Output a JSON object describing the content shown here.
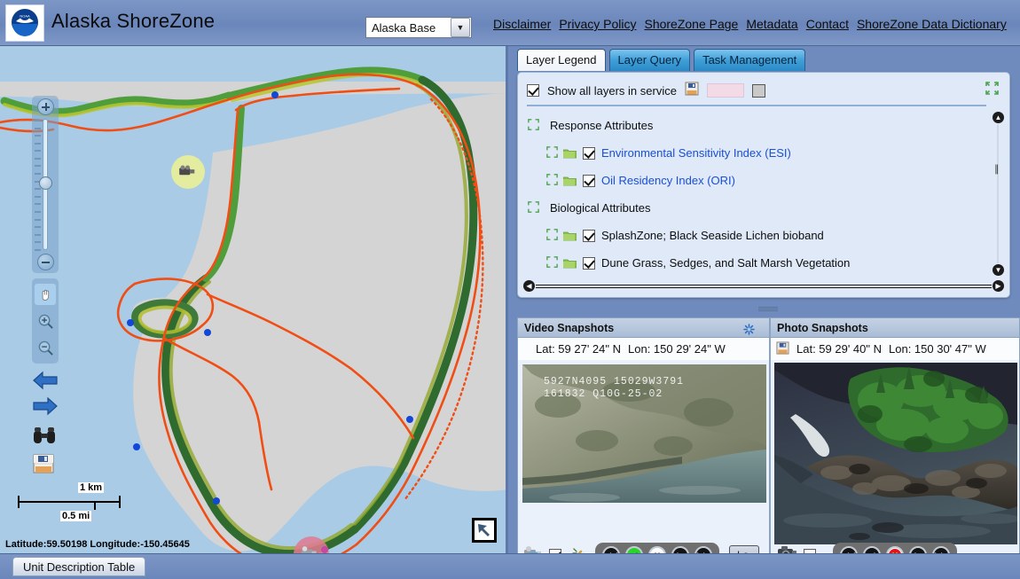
{
  "header": {
    "title": "Alaska ShoreZone",
    "logo_icon": "noaa-logo-icon",
    "basemap": {
      "value": "Alaska Base",
      "options": [
        "Alaska Base"
      ]
    },
    "links": [
      "Disclaimer",
      "Privacy Policy",
      "ShoreZone Page",
      "Metadata",
      "Contact",
      "ShoreZone Data Dictionary"
    ]
  },
  "map": {
    "tools": {
      "zoom_in": "+",
      "zoom_out": "−",
      "pan_icon": "hand-icon",
      "zoom_in_box_icon": "magnifier-plus-icon",
      "zoom_out_box_icon": "magnifier-minus-icon",
      "prev_extent_icon": "blue-left-arrow-icon",
      "next_extent_icon": "blue-right-arrow-icon",
      "identify_icon": "binoculars-icon",
      "save_icon": "floppy-disk-icon",
      "ne_arrow_icon": "northwest-arrow-icon"
    },
    "scalebar": {
      "km": "1 km",
      "mi": "0.5 mi"
    },
    "coords": "Latitude:59.50198   Longitude:-150.45645"
  },
  "legend": {
    "tabs": [
      {
        "label": "Layer Legend",
        "active": true
      },
      {
        "label": "Layer Query",
        "active": false
      },
      {
        "label": "Task Management",
        "active": false
      }
    ],
    "toolbar": {
      "show_all_label": "Show all layers in service",
      "show_all_checked": true,
      "save_icon": "floppy-disk-icon",
      "pink_swatch_color": "#f2dbe7",
      "gray_swatch_color": "#c9c9c9",
      "expand_icon": "expand-arrows-icon"
    },
    "rows": [
      {
        "type": "group",
        "label": "Response Attributes"
      },
      {
        "type": "child",
        "label": "Environmental Sensitivity Index (ESI)",
        "checked": true,
        "link": true
      },
      {
        "type": "child",
        "label": "Oil Residency Index (ORI)",
        "checked": true,
        "link": true
      },
      {
        "type": "group",
        "label": "Biological Attributes"
      },
      {
        "type": "child",
        "label": "SplashZone; Black Seaside Lichen bioband",
        "checked": true,
        "link": false
      },
      {
        "type": "child",
        "label": "Dune Grass, Sedges, and Salt Marsh Vegetation",
        "checked": true,
        "link": false
      }
    ]
  },
  "video_panel": {
    "title": "Video Snapshots",
    "lat_label": "Lat: 59 27' 24\" N",
    "lon_label": "Lon: 150 29' 24\" W",
    "overlay_line1": "5927N4095  15029W3791",
    "overlay_line2": "161832     Q10G-25-02",
    "camcorder_icon": "camcorder-icon",
    "checkbox_checked": true,
    "link_icon": "broken-link-icon",
    "controls": [
      {
        "name": "rewind",
        "glyph": "◀◀",
        "state": "normal"
      },
      {
        "name": "step-back",
        "glyph": "◀",
        "state": "green"
      },
      {
        "name": "stop",
        "glyph": "✕",
        "state": "stop-white"
      },
      {
        "name": "play",
        "glyph": "▶",
        "state": "normal"
      },
      {
        "name": "fast-forward",
        "glyph": "▶▶",
        "state": "normal"
      }
    ],
    "loop_button": "Lo"
  },
  "photo_panel": {
    "title": "Photo Snapshots",
    "save_icon": "floppy-disk-icon",
    "lat_label": "Lat: 59 29' 40\" N",
    "lon_label": "Lon: 150 30' 47\" W",
    "camera_icon": "camera-icon",
    "checkbox_checked": false,
    "controls": [
      {
        "name": "rewind",
        "glyph": "◀◀",
        "state": "normal"
      },
      {
        "name": "step-back",
        "glyph": "◀",
        "state": "normal"
      },
      {
        "name": "stop",
        "glyph": "✕",
        "state": "stop-red"
      },
      {
        "name": "play",
        "glyph": "▶",
        "state": "normal"
      },
      {
        "name": "fast-forward",
        "glyph": "▶▶",
        "state": "normal"
      }
    ]
  },
  "bottom": {
    "unit_table_tab": "Unit Description Table"
  }
}
